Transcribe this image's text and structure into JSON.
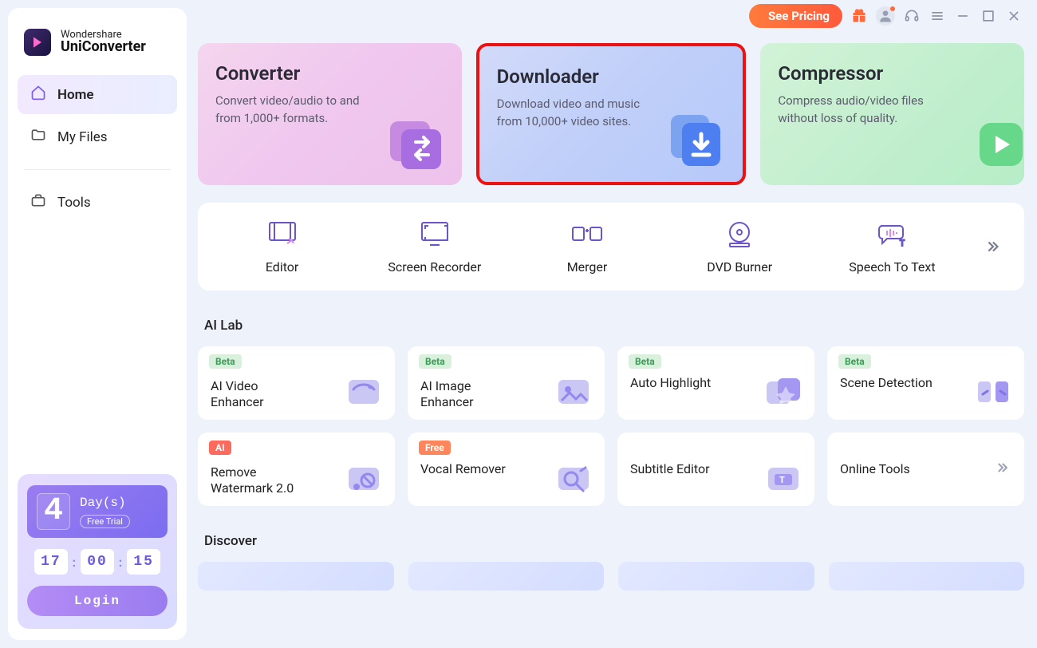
{
  "brand": {
    "line1": "Wondershare",
    "line2": "UniConverter"
  },
  "titlebar": {
    "pricing_label": "See Pricing"
  },
  "sidebar": {
    "items": [
      {
        "label": "Home"
      },
      {
        "label": "My Files"
      },
      {
        "label": "Tools"
      }
    ],
    "trial": {
      "days_number": "4",
      "days_label": "Day(s)",
      "free_trial_label": "Free Trial",
      "countdown": {
        "h": "17",
        "m": "00",
        "s": "15"
      },
      "login_label": "Login"
    }
  },
  "hero": [
    {
      "title": "Converter",
      "desc": "Convert video/audio to and from 1,000+ formats."
    },
    {
      "title": "Downloader",
      "desc": "Download video and music from 10,000+ video sites."
    },
    {
      "title": "Compressor",
      "desc": "Compress audio/video files without loss of quality."
    }
  ],
  "tools": [
    {
      "label": "Editor"
    },
    {
      "label": "Screen Recorder"
    },
    {
      "label": "Merger"
    },
    {
      "label": "DVD Burner"
    },
    {
      "label": "Speech To Text"
    }
  ],
  "sections": {
    "ai_lab_title": "AI Lab",
    "discover_title": "Discover"
  },
  "ai_lab_row1": [
    {
      "badge": "Beta",
      "title": "AI Video Enhancer"
    },
    {
      "badge": "Beta",
      "title": "AI Image Enhancer"
    },
    {
      "badge": "Beta",
      "title": "Auto Highlight"
    },
    {
      "badge": "Beta",
      "title": "Scene Detection"
    }
  ],
  "ai_lab_row2": [
    {
      "badge": "AI",
      "title": "Remove Watermark 2.0"
    },
    {
      "badge": "Free",
      "title": "Vocal Remover"
    },
    {
      "badge": "",
      "title": "Subtitle Editor"
    },
    {
      "badge": "",
      "title": "Online Tools"
    }
  ]
}
